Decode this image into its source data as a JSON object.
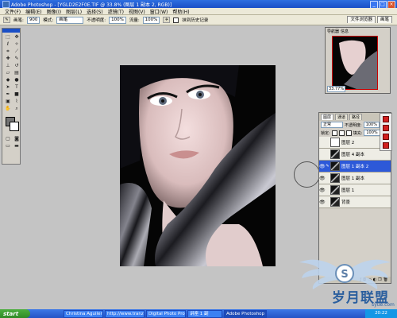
{
  "window": {
    "title": "Adobe Photoshop - [YGLD2E2F0E.TIF @ 33.8% (图层 1 副本 2, RGB)]"
  },
  "menu": [
    "文件(F)",
    "编辑(E)",
    "图像(I)",
    "图层(L)",
    "选择(S)",
    "滤镜(T)",
    "视图(V)",
    "窗口(W)",
    "帮助(H)"
  ],
  "options": {
    "brush_label": "画笔:",
    "brush_size": "900",
    "mode_label": "模式:",
    "mode_value": "画笔",
    "opacity_label": "不透明度:",
    "opacity_value": "100%",
    "flow_label": "流量:",
    "flow_value": "100%",
    "history_label": "抹到历史记录",
    "panel_tabs": [
      "文件浏览器",
      "画笔"
    ]
  },
  "navigator": {
    "tabs": [
      "导航器",
      "信息"
    ],
    "zoom": "33.77%"
  },
  "layers_panel": {
    "tabs": [
      "图层",
      "通道",
      "路径"
    ],
    "blend_mode": "正常",
    "opacity_label": "不透明度:",
    "opacity_value": "100%",
    "lock_label": "锁定:",
    "fill_label": "填充:",
    "fill_value": "100%",
    "layers": [
      {
        "name": "图层 2",
        "selected": false
      },
      {
        "name": "图层 4 副本",
        "selected": false
      },
      {
        "name": "图层 1 副本 2",
        "selected": true
      },
      {
        "name": "图层 1 副本",
        "selected": false
      },
      {
        "name": "图层 1",
        "selected": false
      },
      {
        "name": "背景",
        "selected": false
      }
    ]
  },
  "watermark": {
    "text": "岁月联盟",
    "url": "syue.com"
  },
  "taskbar": {
    "start": "start",
    "tasks": [
      "Christina Aguilera...",
      "http://www.tranzaq...",
      "Digital Photo Professio...",
      "讲座 1 副",
      "Adobe Photoshop - [Y..."
    ],
    "clock": "20:22"
  }
}
